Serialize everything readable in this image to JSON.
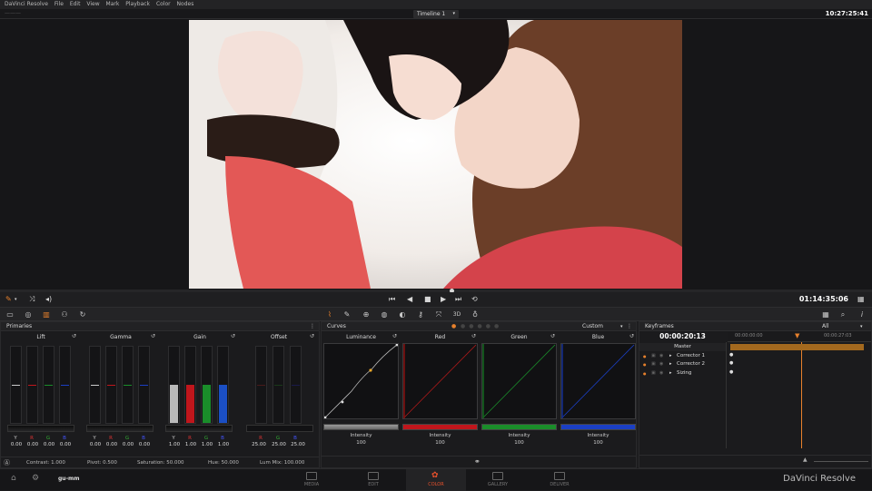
{
  "menu": {
    "app": "DaVinci Resolve",
    "file": "File",
    "edit": "Edit",
    "view": "View",
    "mark": "Mark",
    "playback": "Playback",
    "color": "Color",
    "nodes": "Nodes",
    "project_label": "———"
  },
  "topbar": {
    "timeline": "Timeline 1",
    "timecode": "10:27:25:41"
  },
  "transport": {
    "timecode": "01:14:35:06",
    "buttons": [
      "first-frame",
      "step-back",
      "stop",
      "play",
      "last-frame",
      "loop"
    ]
  },
  "primaries": {
    "title": "Primaries",
    "wheels": [
      {
        "name": "Lift",
        "labels": [
          "Y",
          "R",
          "G",
          "B"
        ],
        "values": [
          "0.00",
          "0.00",
          "0.00",
          "0.00"
        ]
      },
      {
        "name": "Gamma",
        "labels": [
          "Y",
          "R",
          "G",
          "B"
        ],
        "values": [
          "0.00",
          "0.00",
          "0.00",
          "0.00"
        ]
      },
      {
        "name": "Gain",
        "labels": [
          "Y",
          "R",
          "G",
          "B"
        ],
        "values": [
          "1.00",
          "1.00",
          "1.00",
          "1.00"
        ]
      },
      {
        "name": "Offset",
        "labels": [
          "R",
          "G",
          "B"
        ],
        "values": [
          "25.00",
          "25.00",
          "25.00"
        ]
      }
    ],
    "footer": {
      "contrast": "Contrast: 1.000",
      "pivot": "Pivot: 0.500",
      "saturation": "Saturation: 50.000",
      "hue": "Hue: 50.000",
      "lum_mix": "Lum Mix: 100.000"
    }
  },
  "curves": {
    "title": "Curves",
    "mode": "Custom",
    "channels": [
      {
        "name": "Luminance",
        "label": "Intensity",
        "value": "100",
        "color": "#9a9a9a"
      },
      {
        "name": "Red",
        "label": "Intensity",
        "value": "100",
        "color": "#c0161c"
      },
      {
        "name": "Green",
        "label": "Intensity",
        "value": "100",
        "color": "#1a8d2a"
      },
      {
        "name": "Blue",
        "label": "Intensity",
        "value": "100",
        "color": "#1b3fc4"
      }
    ]
  },
  "keyframes": {
    "title": "Keyframes",
    "filter": "All",
    "timecode": "00:00:20:13",
    "ruler_start": "00:00:00:00",
    "ruler_end": "00:00:27:03",
    "rows": [
      "Master",
      "Corrector 1",
      "Corrector 2",
      "Sizing"
    ]
  },
  "pages": [
    {
      "label": "MEDIA",
      "active": false
    },
    {
      "label": "EDIT",
      "active": false
    },
    {
      "label": "COLOR",
      "active": true
    },
    {
      "label": "GALLERY",
      "active": false
    },
    {
      "label": "DELIVER",
      "active": false
    }
  ],
  "footer": {
    "project": "gu-mm",
    "brand": "DaVinci Resolve"
  },
  "colors": {
    "accent": "#e8512c",
    "keyframe_bar": "#a3691e"
  }
}
